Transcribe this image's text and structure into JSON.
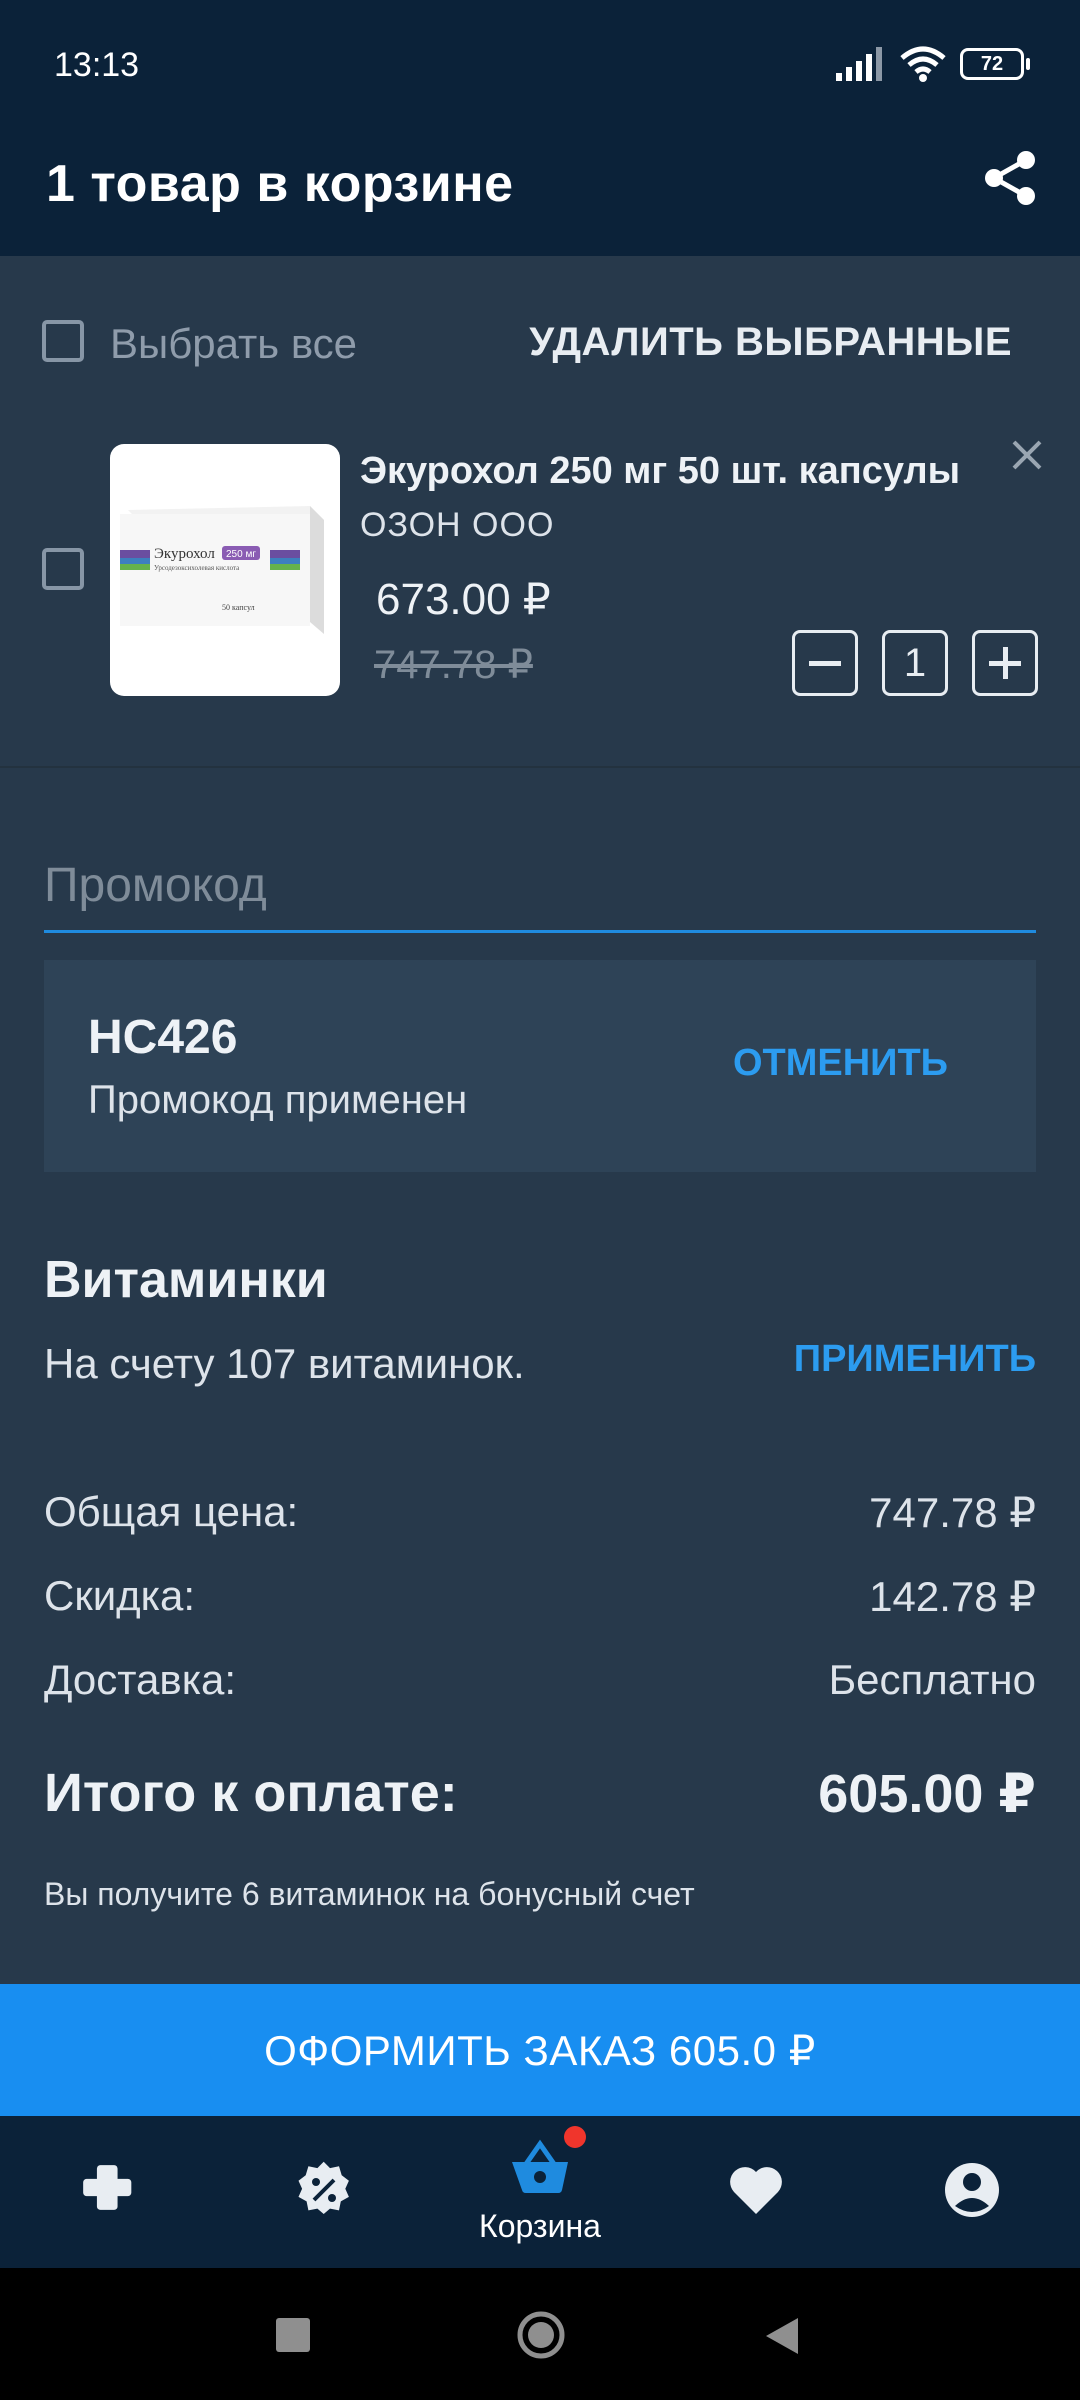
{
  "status_bar": {
    "time": "13:13",
    "battery": "72"
  },
  "header": {
    "title": "1 товар в корзине"
  },
  "select_bar": {
    "select_all_label": "Выбрать все",
    "delete_selected_label": "УДАЛИТЬ ВЫБРАННЫЕ"
  },
  "cart_item": {
    "title": "Экурохол 250 мг 50 шт. капсулы",
    "seller": "ОЗОН ООО",
    "price": "673.00 ₽",
    "old_price": "747.78 ₽",
    "quantity": "1",
    "image_text": {
      "brand": "Экурохол",
      "dose": "250 мг",
      "subtitle": "Урсодезоксихолевая кислота",
      "count": "50 капсул"
    }
  },
  "promo": {
    "placeholder": "Промокод",
    "code": "HC426",
    "status": "Промокод применен",
    "cancel_label": "ОТМЕНИТЬ"
  },
  "vitamins": {
    "title": "Витаминки",
    "balance_text": "На счету 107 витаминок.",
    "apply_label": "ПРИМЕНИТЬ"
  },
  "summary": {
    "total_price_label": "Общая цена:",
    "total_price_value": "747.78 ₽",
    "discount_label": "Скидка:",
    "discount_value": "142.78 ₽",
    "delivery_label": "Доставка:",
    "delivery_value": "Бесплатно",
    "payable_label": "Итого к оплате:",
    "payable_value": "605.00 ₽",
    "bonus_note": "Вы получите 6 витаминок на бонусный счет"
  },
  "checkout": {
    "label": "ОФОРМИТЬ ЗАКАЗ 605.0 ₽"
  },
  "bottom_nav": {
    "items": [
      {
        "icon": "pharmacy-cross-icon",
        "label": ""
      },
      {
        "icon": "discount-badge-icon",
        "label": ""
      },
      {
        "icon": "basket-icon",
        "label": "Корзина",
        "active": true
      },
      {
        "icon": "heart-icon",
        "label": ""
      },
      {
        "icon": "account-icon",
        "label": ""
      }
    ]
  },
  "colors": {
    "background": "#27394b",
    "header": "#0b2239",
    "accent": "#188ef1",
    "link": "#2c9cf0",
    "badge": "#f0352c"
  }
}
